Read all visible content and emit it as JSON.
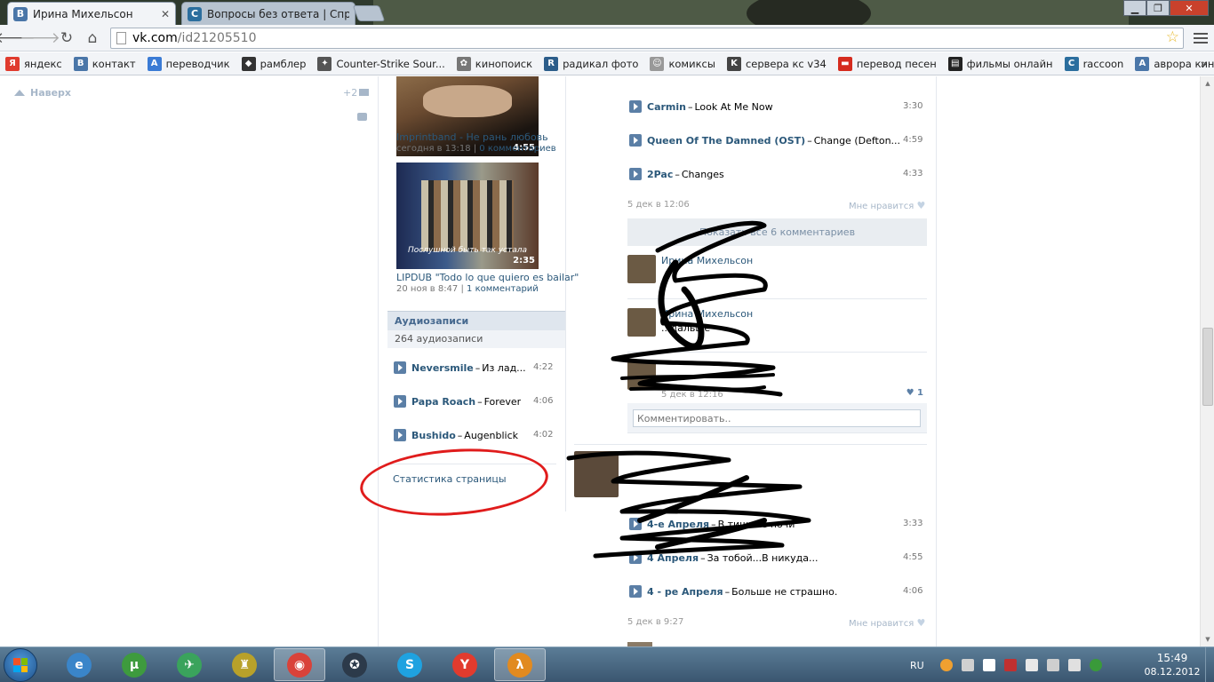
{
  "browser": {
    "tabs": [
      {
        "title": "Ирина Михельсон",
        "favicon": "vk-icon",
        "active": true
      },
      {
        "title": "Вопросы без ответа | Спр",
        "favicon": "c-icon",
        "active": false
      }
    ],
    "url_host": "vk.com",
    "url_path": "/id21205510",
    "bookmarks": [
      {
        "label": "яндекс",
        "icon": "yandex-icon",
        "color": "#e03b2e",
        "glyph": "Я"
      },
      {
        "label": "контакт",
        "icon": "vk-icon",
        "color": "#4a76a8",
        "glyph": "В"
      },
      {
        "label": "переводчик",
        "icon": "translate-icon",
        "color": "#3a7bd5",
        "glyph": "A"
      },
      {
        "label": "рамблер",
        "icon": "rambler-icon",
        "color": "#333333",
        "glyph": "◆"
      },
      {
        "label": "Counter-Strike Sour...",
        "icon": "steam-icon",
        "color": "#555555",
        "glyph": "✦"
      },
      {
        "label": "кинопоиск",
        "icon": "film-reel-icon",
        "color": "#777777",
        "glyph": "✿"
      },
      {
        "label": "радикал фото",
        "icon": "radikal-icon",
        "color": "#2c5d8a",
        "glyph": "R"
      },
      {
        "label": "комиксы",
        "icon": "comic-face-icon",
        "color": "#999999",
        "glyph": "☺"
      },
      {
        "label": "сервера кс v34",
        "icon": "cs-soldier-icon",
        "color": "#444444",
        "glyph": "K"
      },
      {
        "label": "перевод песен",
        "icon": "russian-flag-icon",
        "color": "#d52b1e",
        "glyph": "▬"
      },
      {
        "label": "фильмы онлайн",
        "icon": "film-strip-icon",
        "color": "#222222",
        "glyph": "▤"
      },
      {
        "label": "raccoon",
        "icon": "c-icon",
        "color": "#2b6e9e",
        "glyph": "C"
      },
      {
        "label": "аврора кино",
        "icon": "vk-icon",
        "color": "#4a76a8",
        "glyph": "A"
      }
    ],
    "bookmarks_more": "»"
  },
  "left_nav": {
    "up_label": "Наверх",
    "messages_count": "+2"
  },
  "videos": [
    {
      "title": "Imprintband - Не рань любовь",
      "date": "сегодня в 13:18",
      "comments": "0 комментариев",
      "duration": "4:55"
    },
    {
      "title": "LIPDUB \"Todo lo que quiero es bailar\"",
      "date": "20 ноя в 8:47",
      "comments": "1 комментарий",
      "duration": "2:35",
      "subtitle": "Послушной быть так устала"
    }
  ],
  "audio_block": {
    "heading": "Аудиозаписи",
    "count": "264 аудиозаписи",
    "tracks": [
      {
        "artist": "Neversmile",
        "title": "Из лад...",
        "duration": "4:22"
      },
      {
        "artist": "Papa Roach",
        "title": "Forever",
        "duration": "4:06"
      },
      {
        "artist": "Bushido",
        "title": "Augenblick",
        "duration": "4:02"
      }
    ]
  },
  "page_stats": "Статистика страницы",
  "post1": {
    "tracks": [
      {
        "artist": "Carmin",
        "title": "Look At Me Now",
        "duration": "3:30"
      },
      {
        "artist": "Queen Of The Damned (OST)",
        "title": "Change (Defton...",
        "duration": "4:59"
      },
      {
        "artist": "2Pac",
        "title": "Changes",
        "duration": "4:33"
      }
    ],
    "date": "5 дек в 12:06",
    "like_label": "Мне нравится",
    "show_all": "Показать все 6 комментариев",
    "comments": [
      {
        "name": "Ирина Михельсон",
        "text": "",
        "date": ""
      },
      {
        "name": "Ирина Михельсон",
        "text": "...дальше",
        "date": ""
      },
      {
        "name": "",
        "text": "",
        "date": "5 дек в 12:16",
        "likes": "1"
      }
    ],
    "comment_placeholder": "Комментировать.."
  },
  "post2": {
    "tracks": [
      {
        "artist": "4-е Апреля",
        "title": "В тишине ночи",
        "duration": "3:33"
      },
      {
        "artist": "4 Апреля",
        "title": "За тобой...В никуда...",
        "duration": "4:55"
      },
      {
        "artist": "4 - ре Апреля",
        "title": "Больше не страшно.",
        "duration": "4:06"
      }
    ],
    "date": "5 дек в 9:27",
    "like_label": "Мне нравится"
  },
  "taskbar": {
    "apps": [
      {
        "name": "ie-icon",
        "color": "#3a85c9",
        "glyph": "e"
      },
      {
        "name": "utorrent-icon",
        "color": "#3e9b3e",
        "glyph": "µ"
      },
      {
        "name": "hummingbird-icon",
        "color": "#3aa35c",
        "glyph": "✈"
      },
      {
        "name": "robot-game-icon",
        "color": "#b8a12a",
        "glyph": "♜"
      },
      {
        "name": "chrome-icon",
        "color": "#d9423a",
        "glyph": "◉",
        "active": true
      },
      {
        "name": "counter-strike-icon",
        "color": "#2c3a4a",
        "glyph": "✪"
      },
      {
        "name": "skype-icon",
        "color": "#1fa2e0",
        "glyph": "S"
      },
      {
        "name": "yandex-browser-icon",
        "color": "#e23b2e",
        "glyph": "Y"
      },
      {
        "name": "half-life-2-icon",
        "color": "#e18a20",
        "glyph": "λ",
        "active": true
      }
    ],
    "lang": "RU",
    "time": "15:49",
    "date": "08.12.2012"
  },
  "colors": {
    "vk_link": "#2b587a",
    "vk_header_blue": "#45688e",
    "red_marker": "#e01c1c",
    "scribble": "#000000"
  }
}
